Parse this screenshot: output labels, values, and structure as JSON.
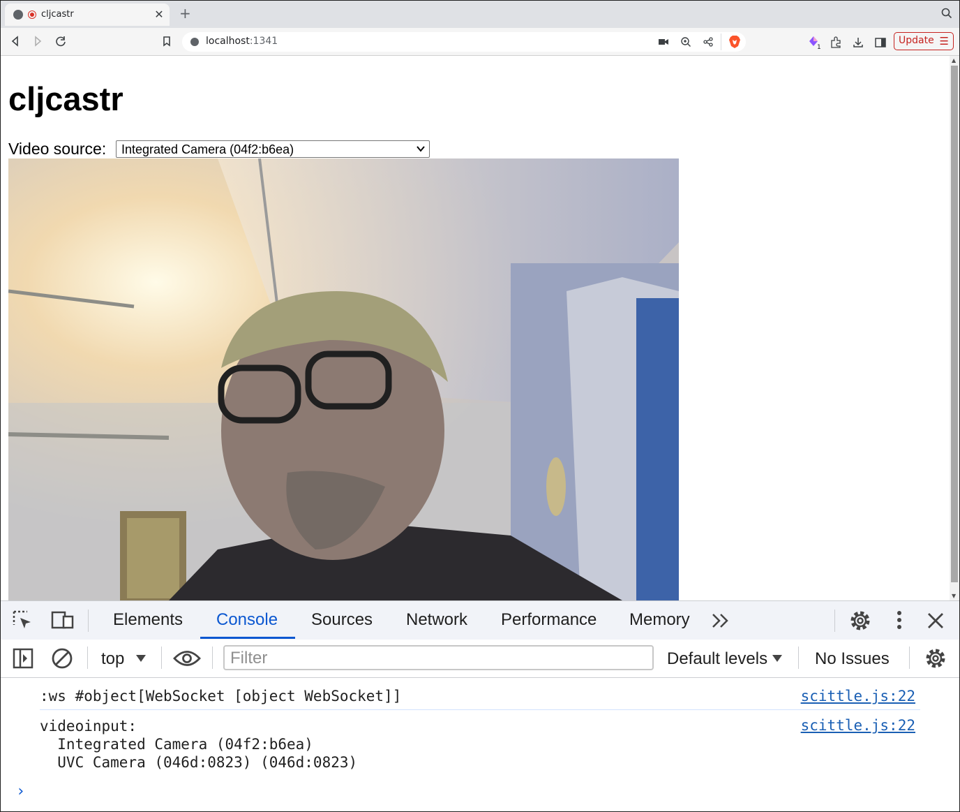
{
  "browser": {
    "tab_title": "cljcastr",
    "tab_close": "✕",
    "new_tab": "+",
    "url_host": "localhost",
    "url_port": ":1341",
    "update_label": "Update",
    "extension_badge": "1"
  },
  "page": {
    "heading": "cljcastr",
    "video_source_label": "Video source:",
    "video_source_selected": "Integrated Camera (04f2:b6ea)"
  },
  "devtools": {
    "tabs": [
      "Elements",
      "Console",
      "Sources",
      "Network",
      "Performance",
      "Memory"
    ],
    "active_tab": "Console",
    "context": "top",
    "filter_placeholder": "Filter",
    "levels": "Default levels",
    "issues": "No Issues",
    "messages": [
      {
        "text": ":ws #object[WebSocket [object WebSocket]]",
        "source": "scittle.js:22"
      },
      {
        "text": "videoinput:\n  Integrated Camera (04f2:b6ea)\n  UVC Camera (046d:0823) (046d:0823)",
        "source": "scittle.js:22"
      }
    ],
    "prompt": "›"
  }
}
